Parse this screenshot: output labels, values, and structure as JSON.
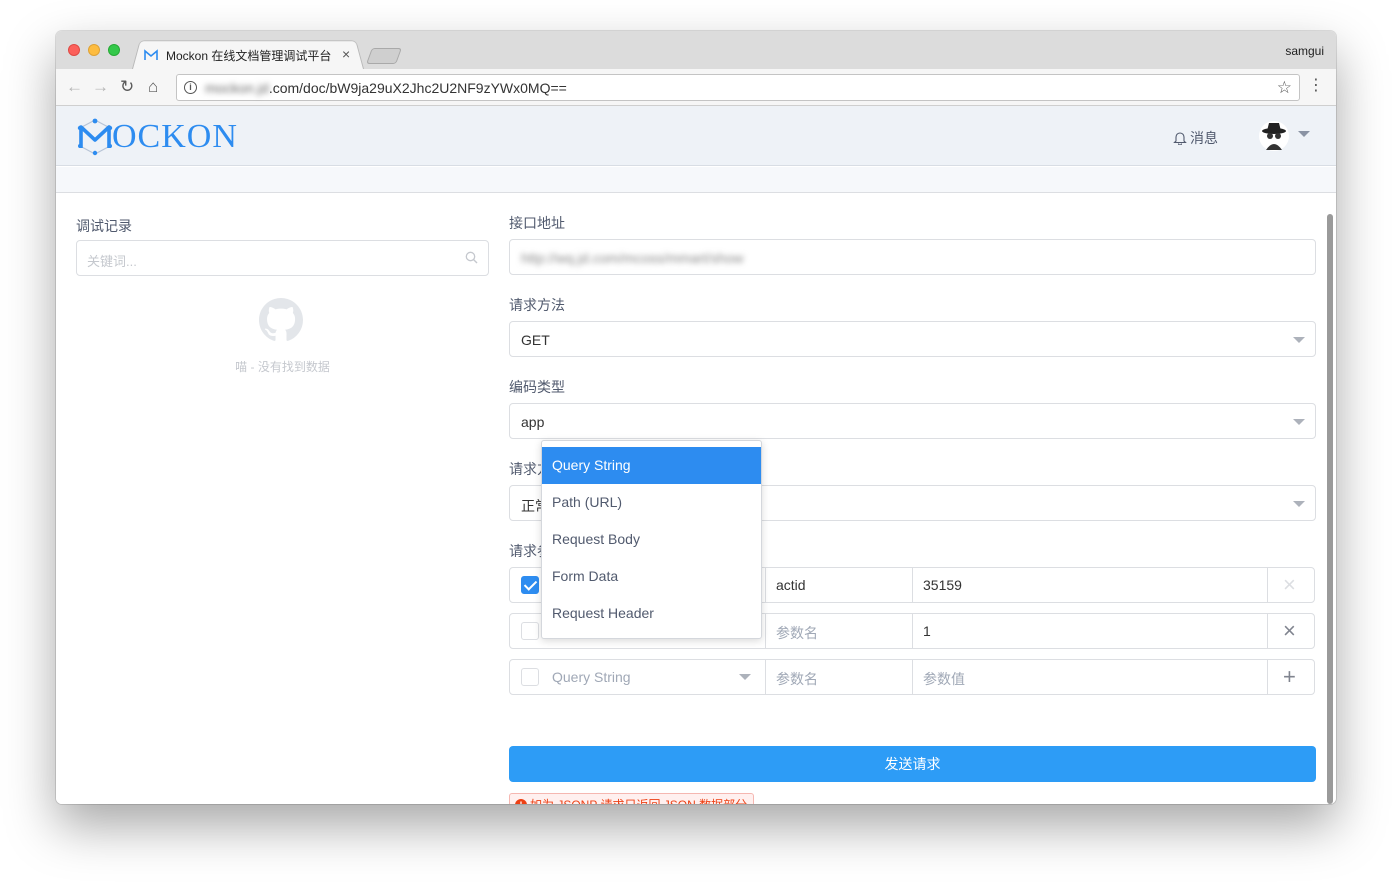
{
  "browser": {
    "tab_title": "Mockon 在线文档管理调试平台",
    "tab_close": "×",
    "profile_name": "samgui",
    "url_blurred": "mockon.jd",
    "url_visible": ".com/doc/bW9ja29uX2Jhc2U2NF9zYWx0MQ==",
    "nav": {
      "back": "←",
      "forward": "→",
      "reload": "↻",
      "home": "⌂",
      "star": "☆",
      "menu": "⋮",
      "info": "i"
    }
  },
  "app": {
    "logo_text": "OCKON",
    "notice_label": "消息",
    "brand_color": "#2d8cf0"
  },
  "history": {
    "title": "调试记录",
    "search_placeholder": "关键词...",
    "empty_text": "喵 - 没有找到数据"
  },
  "form": {
    "url_label": "接口地址",
    "url_value_blurred": "http://wq.jd.com/mcoss/mmart/show",
    "method_label": "请求方法",
    "method_value": "GET",
    "encoding_label": "编码类型",
    "encoding_value": "app",
    "mode_label": "请求方",
    "mode_value": "正常",
    "params_label": "请求参",
    "params": [
      {
        "checked": true,
        "type": "Query String",
        "name": "actid",
        "name_placeholder": "参数名",
        "value": "35159",
        "value_placeholder": "参数值",
        "action": "×",
        "action_enabled": false
      },
      {
        "checked": false,
        "type": "Query String",
        "name": "",
        "name_placeholder": "参数名",
        "value": "1",
        "value_placeholder": "参数值",
        "action": "×",
        "action_enabled": true
      },
      {
        "checked": false,
        "type": "Query String",
        "name": "",
        "name_placeholder": "参数名",
        "value": "",
        "value_placeholder": "参数值",
        "action": "+",
        "action_enabled": true
      }
    ],
    "submit_label": "发送请求",
    "tip_text": "如为 JSONP 请求只返回 JSON 数据部分",
    "tip_icon": "!"
  },
  "dropdown": {
    "options": [
      "Query String",
      "Path (URL)",
      "Request Body",
      "Form Data",
      "Request Header"
    ],
    "selected": "Query String"
  }
}
